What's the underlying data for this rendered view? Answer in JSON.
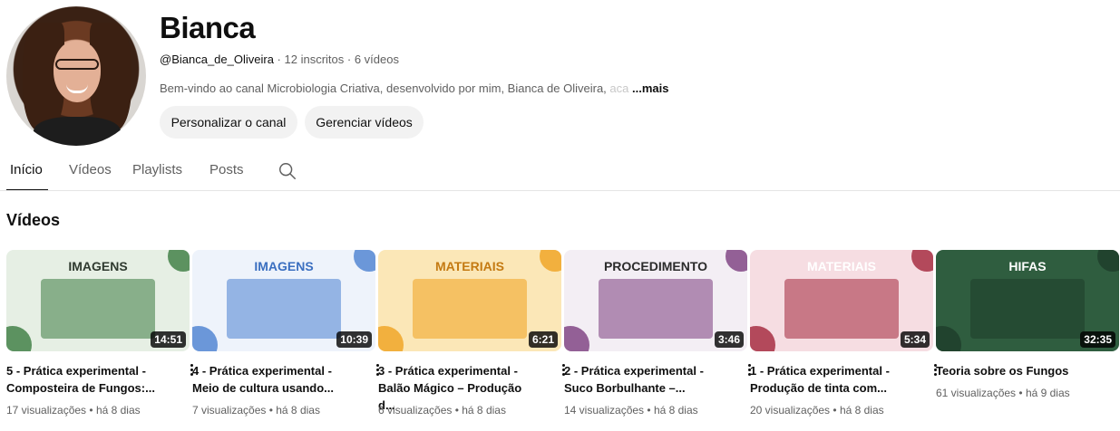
{
  "channel": {
    "name": "Bianca",
    "handle": "@Bianca_de_Oliveira",
    "subscribers": "12 inscritos",
    "video_count": "6 vídeos",
    "separator": " · ",
    "description": "Bem-vindo ao canal Microbiologia Criativa, desenvolvido por mim, Bianca de Oliveira,",
    "description_fade": " aca",
    "more_label": "...mais",
    "customize_button": "Personalizar o canal",
    "manage_button": "Gerenciar vídeos"
  },
  "tabs": [
    {
      "label": "Início",
      "active": true
    },
    {
      "label": "Vídeos",
      "active": false
    },
    {
      "label": "Playlists",
      "active": false
    },
    {
      "label": "Posts",
      "active": false
    }
  ],
  "icons": {
    "search": "search-icon",
    "menu": "more-vertical-icon"
  },
  "section_title": "Vídeos",
  "videos": [
    {
      "title_line1": "5 - Prática experimental -",
      "title_line2": "Composteira de Fungos:...",
      "views": "17 visualizações",
      "age": "há 8 dias",
      "duration": "14:51",
      "thumb_text": "IMAGENS",
      "bg": "#e6efe4",
      "accent": "#3a7a3f",
      "text_color": "#2f3a2f"
    },
    {
      "title_line1": "4 - Prática experimental -",
      "title_line2": "Meio de cultura usando...",
      "views": "7 visualizações",
      "age": "há 8 dias",
      "duration": "10:39",
      "thumb_text": "IMAGENS",
      "bg": "#eef3fb",
      "accent": "#4a7fd1",
      "text_color": "#3b6fc0"
    },
    {
      "title_line1": "3 - Prática experimental -",
      "title_line2": "Balão Mágico – Produção d...",
      "views": "6 visualizações",
      "age": "há 8 dias",
      "duration": "6:21",
      "thumb_text": "MATERIAIS",
      "bg": "#fbe7b7",
      "accent": "#f0a31f",
      "text_color": "#c47a12"
    },
    {
      "title_line1": "2 - Prática experimental -",
      "title_line2": "Suco Borbulhante –...",
      "views": "14 visualizações",
      "age": "há 8 dias",
      "duration": "3:46",
      "thumb_text": "PROCEDIMENTO",
      "bg": "#f3eef4",
      "accent": "#7a3c7e",
      "text_color": "#2b2b2b"
    },
    {
      "title_line1": "1 - Prática experimental -",
      "title_line2": "Produção de tinta com...",
      "views": "20 visualizações",
      "age": "há 8 dias",
      "duration": "5:34",
      "thumb_text": "MATERIAIS",
      "bg": "#f6dde2",
      "accent": "#a3243a",
      "text_color": "#ffffff"
    },
    {
      "title_line1": "Teoria sobre os Fungos",
      "title_line2": "",
      "views": "61 visualizações",
      "age": "há 9 dias",
      "duration": "32:35",
      "thumb_text": "HIFAS",
      "bg": "#2f5d3f",
      "accent": "#1e3d2a",
      "text_color": "#ffffff"
    }
  ]
}
